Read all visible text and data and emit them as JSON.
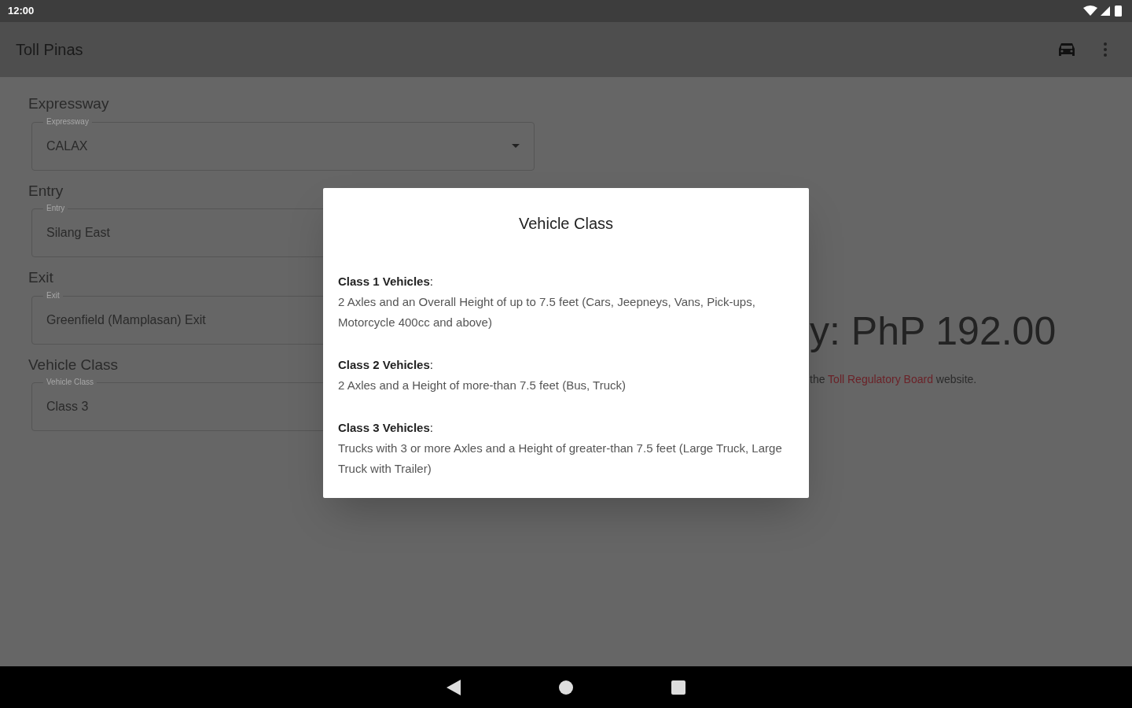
{
  "status_bar": {
    "time": "12:00"
  },
  "app_bar": {
    "title": "Toll Pinas"
  },
  "form": [
    {
      "heading": "Expressway",
      "label": "Expressway",
      "value": "CALAX"
    },
    {
      "heading": "Entry",
      "label": "Entry",
      "value": "Silang East"
    },
    {
      "heading": "Exit",
      "label": "Exit",
      "value": "Greenfield (Mamplasan) Exit"
    },
    {
      "heading": "Vehicle Class",
      "label": "Vehicle Class",
      "value": "Class 3"
    }
  ],
  "fare": {
    "amount": "y: PhP 192.00",
    "note_before": "the",
    "link": "Toll Regulatory Board",
    "note_after": "website."
  },
  "dialog": {
    "title": "Vehicle Class",
    "sections": [
      {
        "heading": "**Class 1 Vehicles**:",
        "text": "2 Axles and an Overall Height of up to 7.5 feet (Cars, Jeepneys, Vans, Pick-ups, Motorcycle 400cc and above)"
      },
      {
        "heading": "**Class 2 Vehicles**:",
        "text": "2 Axles and a Height of more-than 7.5 feet (Bus, Truck)"
      },
      {
        "heading": "**Class 3 Vehicles**:",
        "text": "Trucks with 3 or more Axles and a Height of greater-than 7.5 feet (Large Truck, Large Truck with Trailer)"
      }
    ]
  }
}
